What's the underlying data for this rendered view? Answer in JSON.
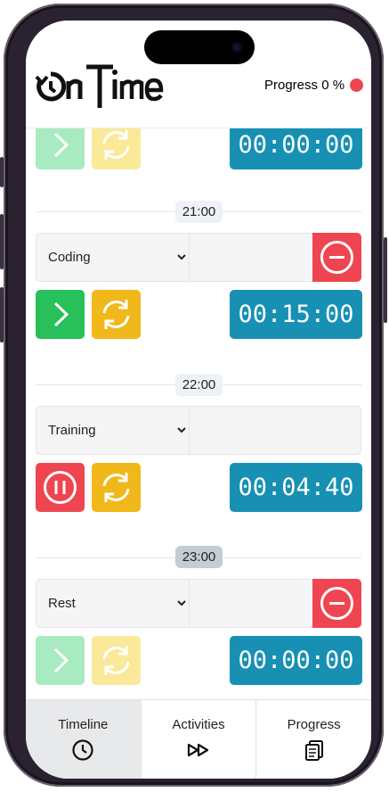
{
  "app": {
    "logo_text": "OnTime"
  },
  "header": {
    "progress_label": "Progress 0 %"
  },
  "timeline": {
    "slots": [
      {
        "time": "21:00",
        "current": false
      },
      {
        "time": "22:00",
        "current": false
      },
      {
        "time": "23:00",
        "current": true
      }
    ],
    "activities": [
      {
        "name": "",
        "timer": "00:00:00",
        "state": "disabled"
      },
      {
        "name": "Coding",
        "timer": "00:15:00",
        "state": "ready"
      },
      {
        "name": "Training",
        "timer": "00:04:40",
        "state": "running"
      },
      {
        "name": "Rest",
        "timer": "00:00:00",
        "state": "disabled"
      }
    ]
  },
  "nav": {
    "tabs": [
      {
        "label": "Timeline",
        "icon": "clock-icon",
        "active": true
      },
      {
        "label": "Activities",
        "icon": "fast-forward-icon",
        "active": false
      },
      {
        "label": "Progress",
        "icon": "clipboard-icon",
        "active": false
      }
    ]
  },
  "colors": {
    "accent_teal": "#1790b4",
    "green": "#28c05a",
    "yellow": "#f0b81a",
    "red": "#ef4550"
  }
}
